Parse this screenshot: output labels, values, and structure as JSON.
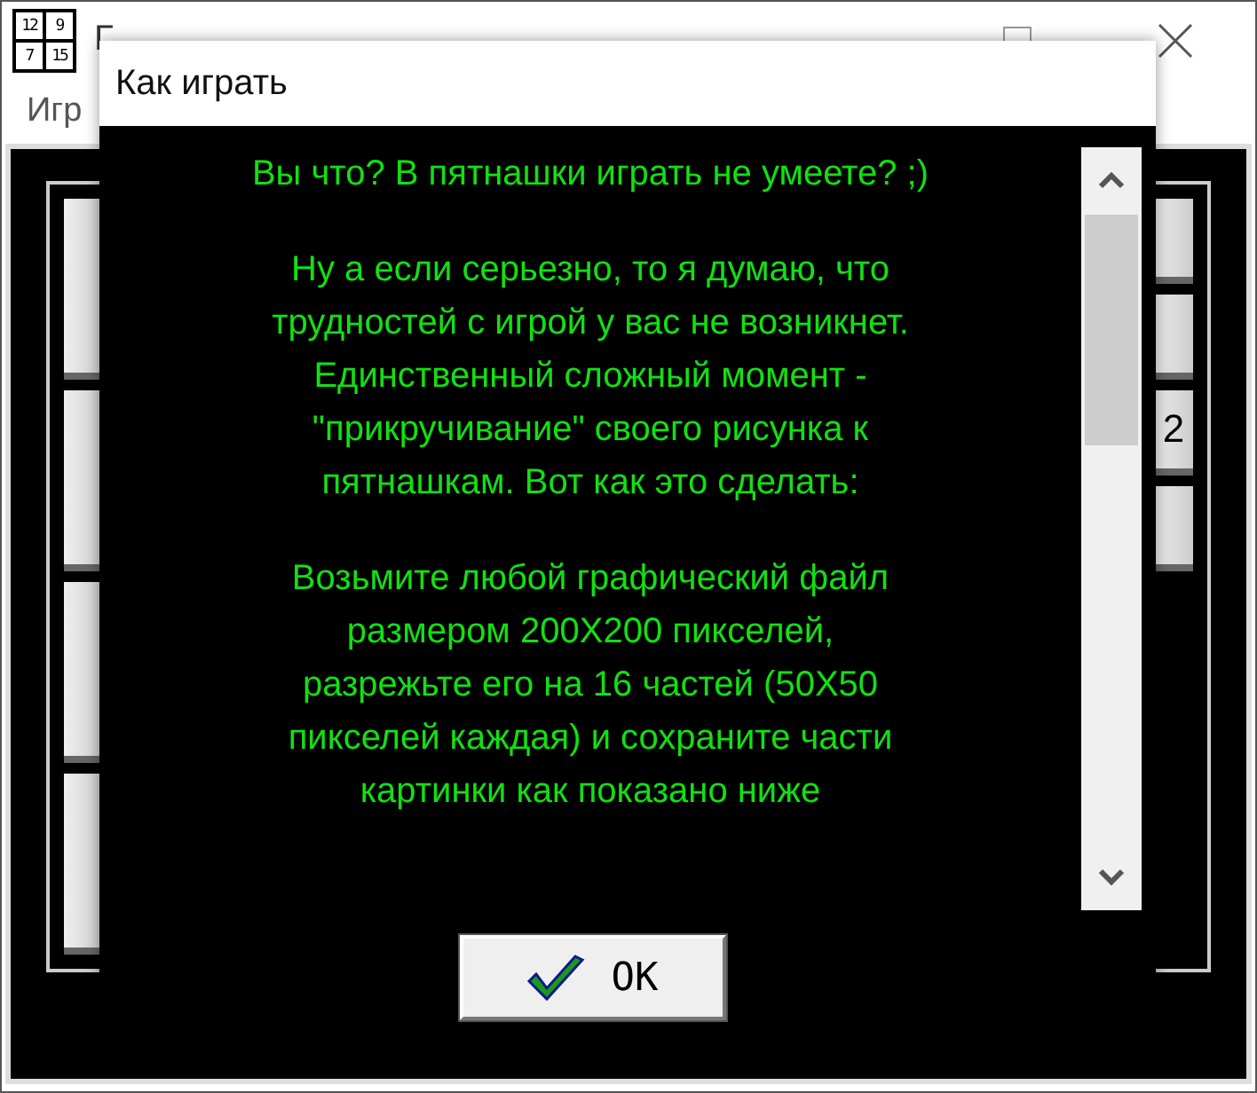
{
  "main_window": {
    "icon_digits": [
      "12",
      "9",
      "7",
      "15"
    ],
    "title": "Г",
    "menu": [
      "Игр"
    ],
    "left_tiles": [
      {
        "kind": "blank"
      },
      {
        "kind": "blank"
      },
      {
        "kind": "blank"
      },
      {
        "kind": "blank"
      }
    ],
    "right_tiles": [
      {
        "kind": "blank"
      },
      {
        "kind": "blank"
      },
      {
        "kind": "number",
        "label": "2"
      },
      {
        "kind": "blank"
      }
    ]
  },
  "dialog": {
    "title": "Как играть",
    "paragraphs": [
      {
        "lines": [
          "Вы что? В пятнашки играть не умеете? ;)"
        ]
      },
      {
        "lines": [
          "Ну а если серьезно, то я думаю, что",
          "трудностей с игрой у вас не возникнет.",
          "Единственный сложный момент -",
          "\"прикручивание\" своего рисунка к",
          "пятнашкам. Вот как это сделать:"
        ]
      },
      {
        "lines": [
          "Возьмите любой графический файл",
          "размером 200X200 пикселей,",
          "разрежьте его на 16 частей (50X50",
          "пикселей каждая) и сохраните части",
          "картинки как показано ниже"
        ]
      }
    ],
    "ok_button": "OK"
  }
}
